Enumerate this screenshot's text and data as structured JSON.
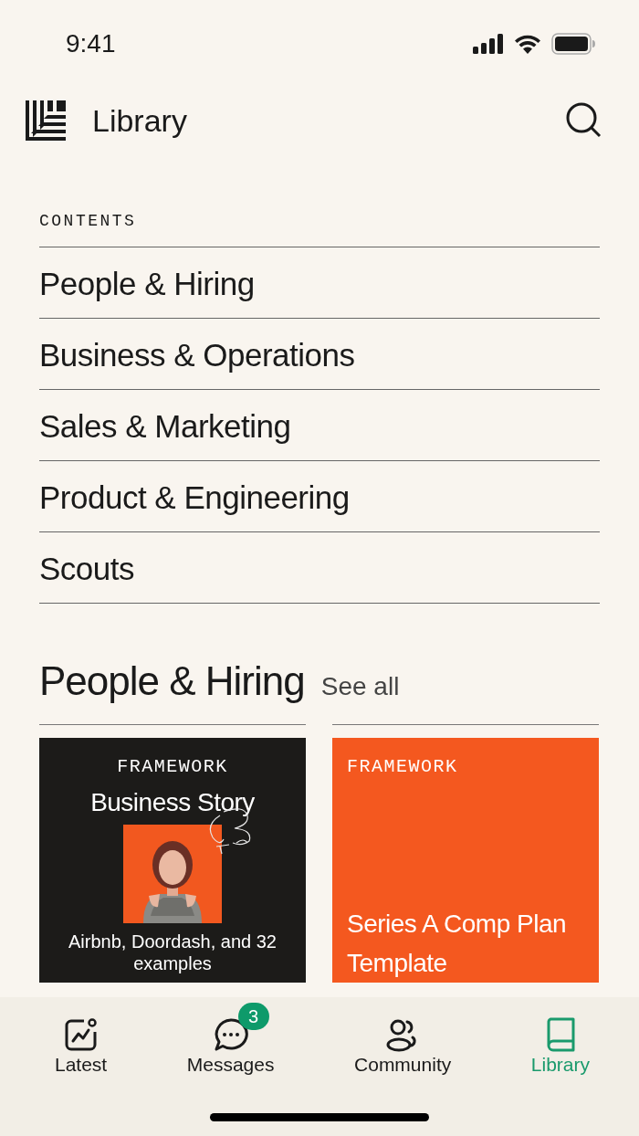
{
  "status_bar": {
    "time": "9:41"
  },
  "header": {
    "title": "Library"
  },
  "contents": {
    "label": "CONTENTS",
    "items": [
      {
        "label": "People & Hiring"
      },
      {
        "label": "Business & Operations"
      },
      {
        "label": "Sales & Marketing"
      },
      {
        "label": "Product & Engineering"
      },
      {
        "label": "Scouts"
      }
    ]
  },
  "section": {
    "title": "People & Hiring",
    "see_all": "See all"
  },
  "cards": [
    {
      "kind": "story",
      "tag": "FRAMEWORK",
      "title": "Business Story",
      "caption": "Airbnb, Doordash, and 32 examples"
    },
    {
      "kind": "template",
      "tag": "FRAMEWORK",
      "title": "Series A Comp Plan Template"
    }
  ],
  "tab_bar": [
    {
      "label": "Latest",
      "kind": "chart",
      "selected": false
    },
    {
      "label": "Messages",
      "kind": "chat",
      "badge": "3",
      "selected": false
    },
    {
      "label": "Community",
      "kind": "people",
      "selected": false
    },
    {
      "label": "Library",
      "kind": "book",
      "selected": true
    }
  ]
}
